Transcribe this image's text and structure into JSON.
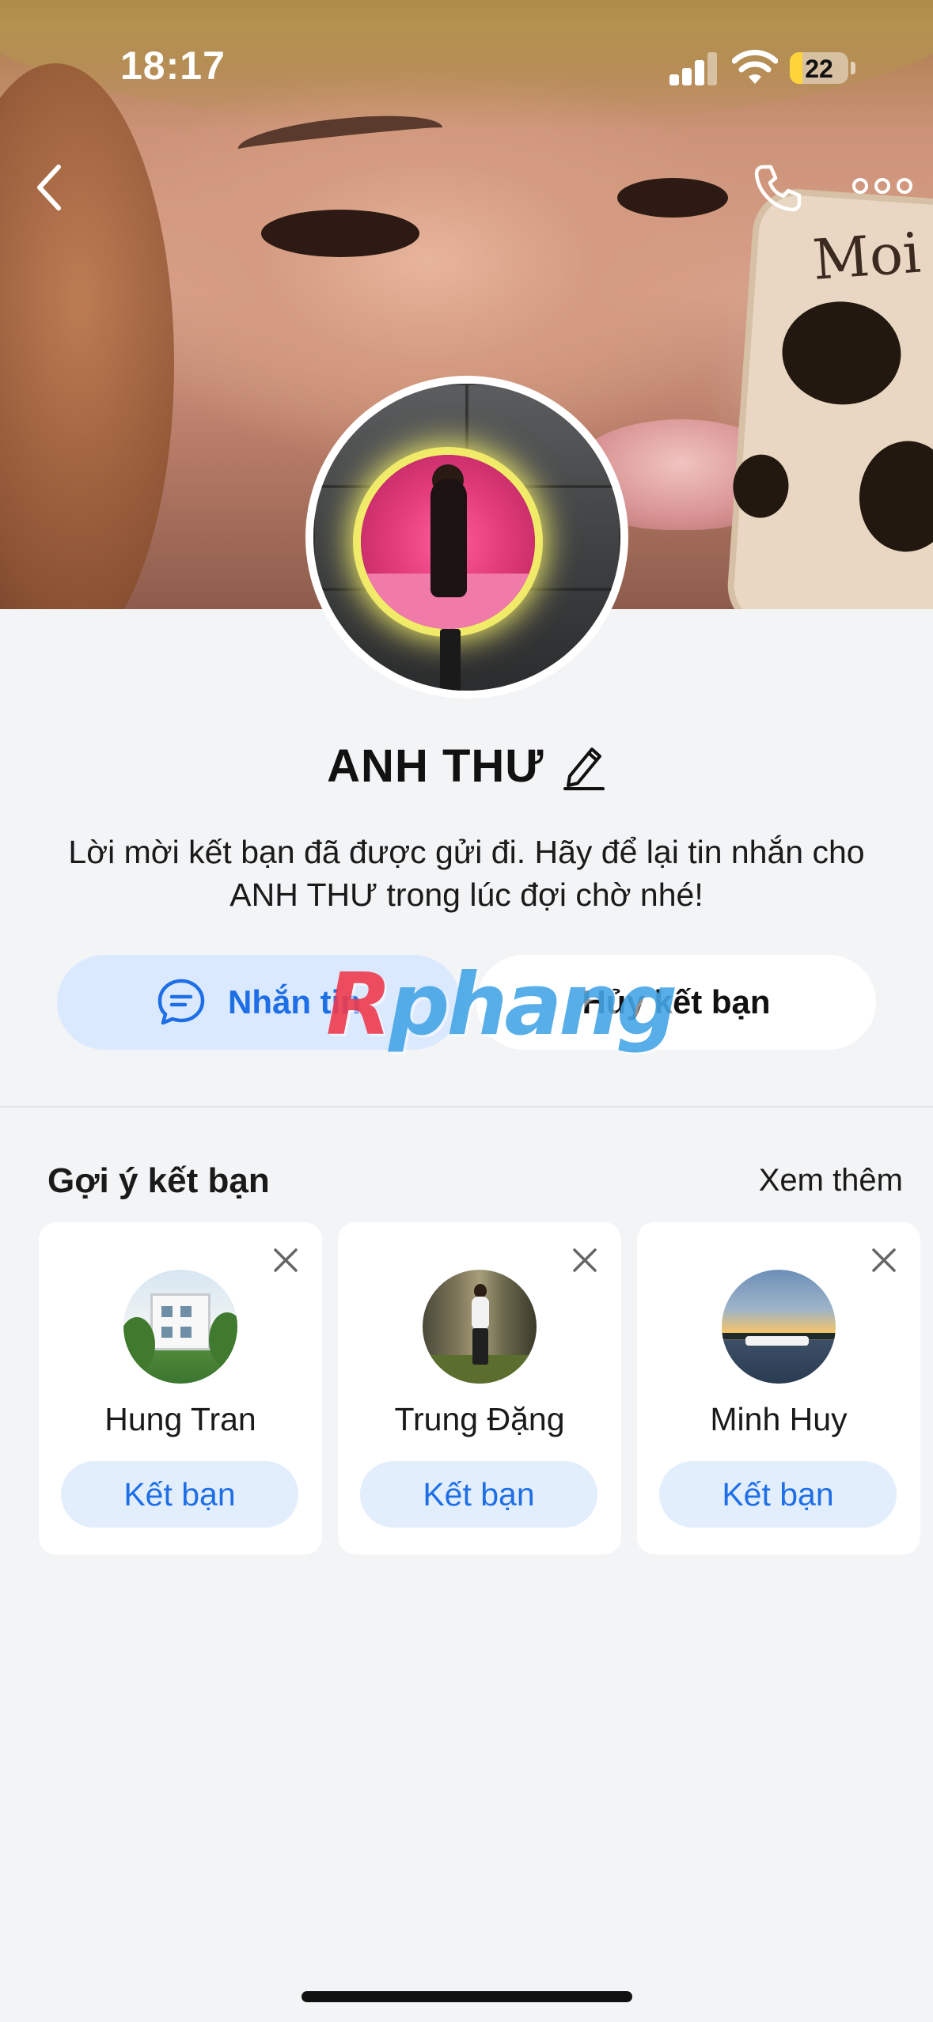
{
  "status_bar": {
    "time": "18:17",
    "battery": "22",
    "battery_level": 0.22
  },
  "profile": {
    "name": "ANH THƯ",
    "message": "Lời mời kết bạn đã được gửi đi. Hãy để lại tin nhắn cho ANH THƯ trong lúc đợi chờ nhé!"
  },
  "actions": {
    "message_label": "Nhắn tin",
    "cancel_label": "Hủy kết bạn"
  },
  "watermark": {
    "first_letter": "R",
    "rest": "phang"
  },
  "suggestions": {
    "title": "Gợi ý kết bạn",
    "see_more": "Xem thêm",
    "items": [
      {
        "name": "Hung Tran",
        "button": "Kết bạn"
      },
      {
        "name": "Trung Đặng",
        "button": "Kết bạn"
      },
      {
        "name": "Minh Huy",
        "button": "Kết bạn"
      }
    ]
  },
  "icons": {
    "back": "chevron-left-icon",
    "call": "phone-icon",
    "more": "more-horizontal-icon",
    "edit": "pencil-icon",
    "chat": "chat-bubble-icon",
    "close": "close-icon"
  },
  "colors": {
    "accent": "#1e6fe6",
    "accent_bg": "#dbe9ff",
    "background": "#f3f4f5"
  }
}
